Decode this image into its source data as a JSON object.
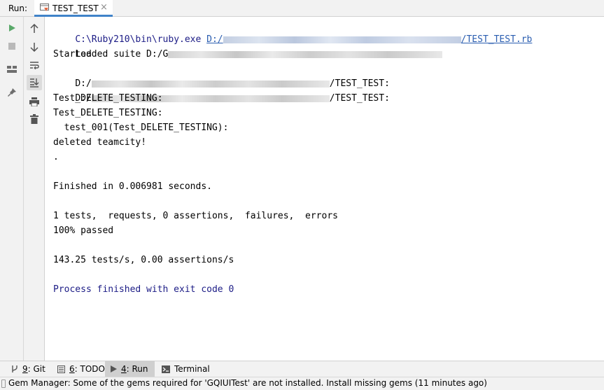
{
  "header": {
    "run_label": "Run:",
    "tab_label": "TEST_TEST",
    "tab_close": "×"
  },
  "console": {
    "cmd_prefix": "C:\\Ruby210\\bin\\ruby.exe ",
    "cmd_link_start": "D:/",
    "cmd_link_end": "/TEST_TEST.rb",
    "loaded": "Loaded suite D:/G",
    "started": "Started",
    "path1_prefix": "D:/",
    "path1_suffix": "/TEST_TEST:",
    "path2_prefix": "D:/",
    "path2_suffix": "/TEST_TEST:",
    "delete1": "Test_DELETE_TESTING:",
    "delete2": "Test_DELETE_TESTING:",
    "test001": "  test_001(Test_DELETE_TESTING):",
    "deleted": "deleted teamcity!",
    "dot": ".",
    "finished": "Finished in 0.006981 seconds.",
    "summary": "1 tests,  requests, 0 assertions,  failures,  errors",
    "passed": "100% passed",
    "rate": "143.25 tests/s, 0.00 assertions/s",
    "exit": "Process finished with exit code 0"
  },
  "bottom_tabs": [
    {
      "num": "9",
      "label": ": Git"
    },
    {
      "num": "6",
      "label": ": TODO"
    },
    {
      "num": "4",
      "label": ": Run"
    },
    {
      "num": "",
      "label": "Terminal"
    }
  ],
  "status": {
    "message": "Gem Manager: Some of the gems required for 'GQIUITest' are not installed. Install missing gems (11 minutes ago)"
  },
  "colors": {
    "accent": "#4083c9",
    "run_green": "#59a869",
    "console_blue": "#1c1c86",
    "link_blue": "#2a5db0"
  }
}
